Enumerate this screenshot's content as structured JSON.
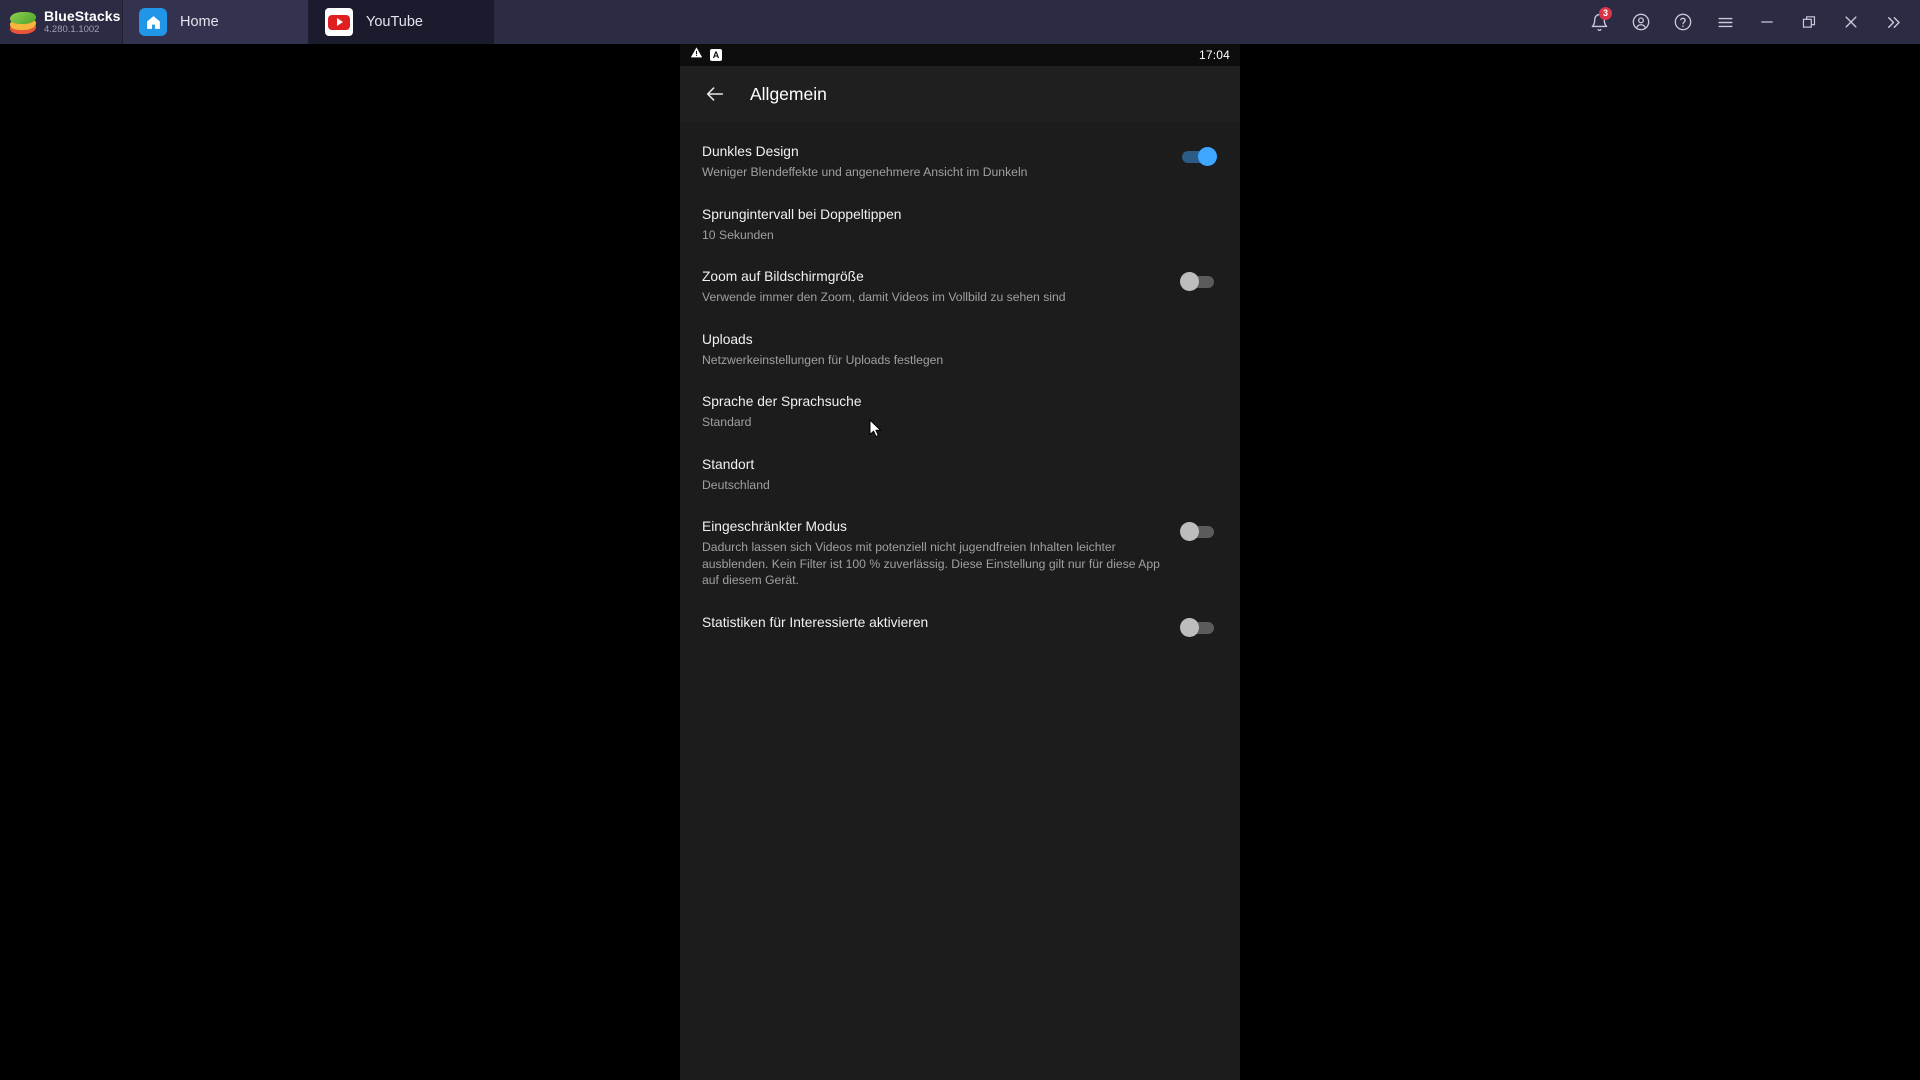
{
  "window": {
    "brand": {
      "name": "BlueStacks",
      "version": "4.280.1.1002",
      "logo_icon": "bluestacks-logo"
    },
    "tabs": [
      {
        "label": "Home",
        "icon": "home-icon",
        "active": false
      },
      {
        "label": "YouTube",
        "icon": "youtube-icon",
        "active": true
      }
    ],
    "actions": [
      {
        "name": "notifications-button",
        "icon": "bell-icon",
        "badge": "3"
      },
      {
        "name": "account-button",
        "icon": "account-circle-icon"
      },
      {
        "name": "help-button",
        "icon": "help-circle-icon"
      },
      {
        "name": "menu-button",
        "icon": "hamburger-menu-icon"
      },
      {
        "name": "minimize-button",
        "icon": "minimize-icon"
      },
      {
        "name": "restore-button",
        "icon": "restore-window-icon"
      },
      {
        "name": "close-button",
        "icon": "close-icon"
      },
      {
        "name": "expand-sidebar-button",
        "icon": "chevron-double-right-icon"
      }
    ],
    "colors": {
      "titlebar_bg": "#2b2b43",
      "tab_inactive_bg": "#333350",
      "tab_active_bg": "#1b1b2e",
      "notification_badge": "#d8344a"
    }
  },
  "android": {
    "status_bar": {
      "time": "17:04",
      "icons": [
        "warning-triangle-icon",
        "app-a-icon"
      ]
    }
  },
  "app": {
    "header": {
      "back_icon": "back-arrow-icon",
      "title": "Allgemein"
    },
    "settings": [
      {
        "title": "Dunkles Design",
        "subtitle": "Weniger Blendeffekte und angenehmere Ansicht im Dunkeln",
        "control": "toggle",
        "state": "on"
      },
      {
        "title": "Sprungintervall bei Doppeltippen",
        "subtitle": "10 Sekunden",
        "control": "none",
        "state": ""
      },
      {
        "title": "Zoom auf Bildschirmgröße",
        "subtitle": "Verwende immer den Zoom, damit Videos im Vollbild zu sehen sind",
        "control": "toggle",
        "state": "off"
      },
      {
        "title": "Uploads",
        "subtitle": "Netzwerkeinstellungen für Uploads festlegen",
        "control": "none",
        "state": ""
      },
      {
        "title": "Sprache der Sprachsuche",
        "subtitle": "Standard",
        "control": "none",
        "state": ""
      },
      {
        "title": "Standort",
        "subtitle": "Deutschland",
        "control": "none",
        "state": ""
      },
      {
        "title": "Eingeschränkter Modus",
        "subtitle": "Dadurch lassen sich Videos mit potenziell nicht jugendfreien Inhalten leichter ausblenden. Kein Filter ist 100 % zuverlässig. Diese Einstellung gilt nur für diese App auf diesem Gerät.",
        "control": "toggle",
        "state": "off"
      },
      {
        "title": "Statistiken für Interessierte aktivieren",
        "subtitle": "",
        "control": "toggle",
        "state": "off"
      }
    ],
    "colors": {
      "screen_bg": "#1c1c1c",
      "header_bg": "#1f1f1f",
      "status_bg": "#0d0d0d",
      "toggle_on": "#3ea6ff",
      "title_text": "#f1f1f1",
      "subtitle_text": "#a0a0a0"
    }
  },
  "pointer": {
    "icon": "mouse-cursor-icon"
  }
}
